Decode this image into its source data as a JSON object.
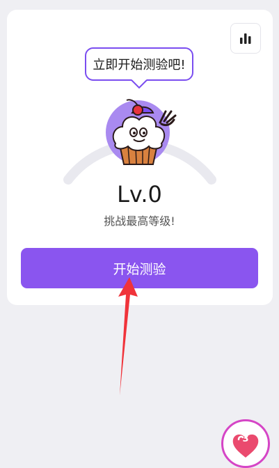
{
  "bubble": {
    "text": "立即开始测验吧!"
  },
  "level": {
    "label": "Lv.0",
    "subtitle": "挑战最高等级!"
  },
  "actions": {
    "start_label": "开始测验"
  },
  "heart": {
    "count": "3"
  },
  "icons": {
    "stats": "bar-chart-icon",
    "heart": "heart-icon",
    "mascot": "cupcake-mascot-icon",
    "annotation": "red-arrow"
  },
  "colors": {
    "accent": "#8a55ef",
    "bubble_border": "#7a4df0",
    "heart_ring": "#d545c6",
    "arrow": "#f0333a"
  }
}
